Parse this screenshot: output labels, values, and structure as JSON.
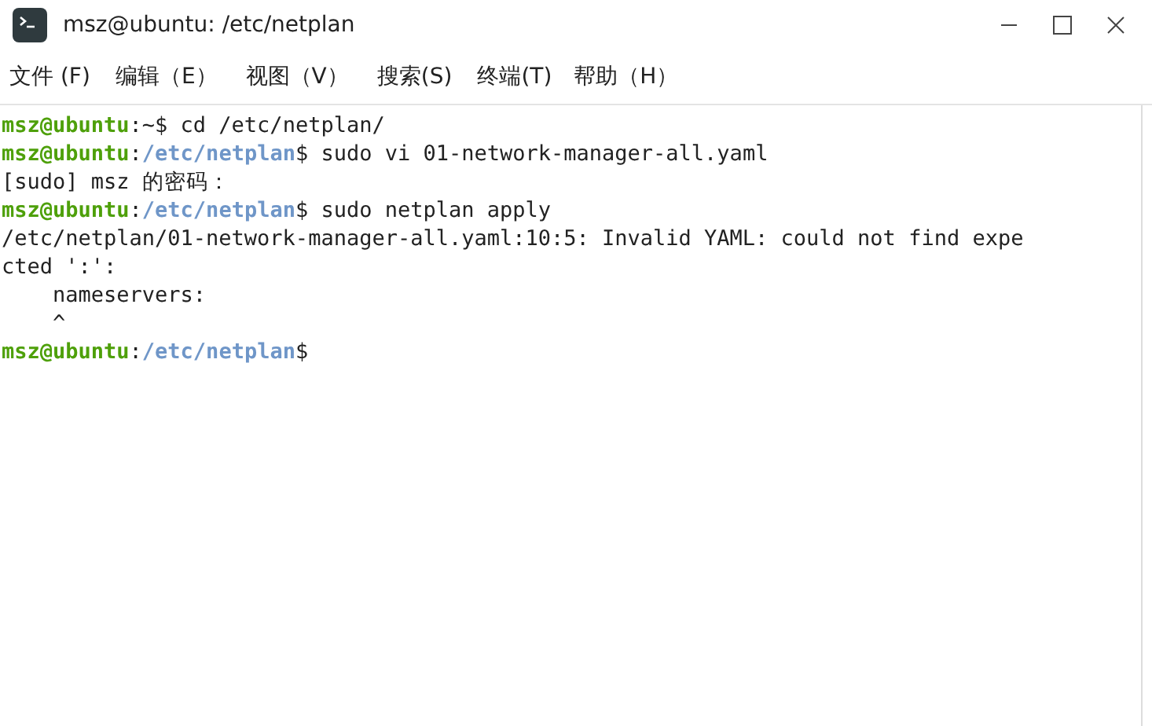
{
  "window": {
    "title": "msz@ubuntu: /etc/netplan"
  },
  "menu": [
    "文件 (F)",
    "编辑（E）",
    "视图（V）",
    "搜索(S)",
    "终端(T)",
    "帮助（H）"
  ],
  "terminal": {
    "lines": [
      [
        {
          "kind": "user",
          "text": "msz@ubuntu"
        },
        {
          "kind": "plain",
          "text": ":~$ cd /etc/netplan/"
        }
      ],
      [
        {
          "kind": "user",
          "text": "msz@ubuntu"
        },
        {
          "kind": "plain",
          "text": ":"
        },
        {
          "kind": "path",
          "text": "/etc/netplan"
        },
        {
          "kind": "plain",
          "text": "$ sudo vi 01-network-manager-all.yaml"
        }
      ],
      [
        {
          "kind": "plain",
          "text": "[sudo] msz 的密码："
        }
      ],
      [
        {
          "kind": "user",
          "text": "msz@ubuntu"
        },
        {
          "kind": "plain",
          "text": ":"
        },
        {
          "kind": "path",
          "text": "/etc/netplan"
        },
        {
          "kind": "plain",
          "text": "$ sudo netplan apply"
        }
      ],
      [
        {
          "kind": "plain",
          "text": "/etc/netplan/01-network-manager-all.yaml:10:5: Invalid YAML: could not find expe"
        }
      ],
      [
        {
          "kind": "plain",
          "text": "cted ':':"
        }
      ],
      [
        {
          "kind": "plain",
          "text": "    nameservers:"
        }
      ],
      [
        {
          "kind": "plain",
          "text": "    ^"
        }
      ],
      [
        {
          "kind": "user",
          "text": "msz@ubuntu"
        },
        {
          "kind": "plain",
          "text": ":"
        },
        {
          "kind": "path",
          "text": "/etc/netplan"
        },
        {
          "kind": "plain",
          "text": "$"
        }
      ]
    ]
  }
}
